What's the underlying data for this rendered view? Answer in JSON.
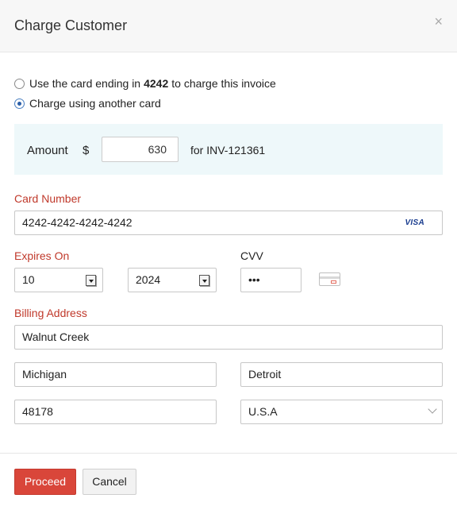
{
  "dialog": {
    "title": "Charge Customer",
    "close_glyph": "×"
  },
  "payment_options": [
    {
      "prefix": "Use the card ending in",
      "card_last4": "4242",
      "suffix": "to charge this invoice",
      "selected": false
    },
    {
      "label": "Charge using another card",
      "selected": true
    }
  ],
  "amount": {
    "label": "Amount",
    "currency": "$",
    "value": "630",
    "for_text": "for INV-121361"
  },
  "card": {
    "number_label": "Card Number",
    "number_value": "4242-4242-4242-4242",
    "brand": "VISA"
  },
  "expiry": {
    "label": "Expires On",
    "month": "10",
    "year": "2024"
  },
  "cvv": {
    "label": "CVV",
    "value": "•••",
    "icon": "card-cvv-icon"
  },
  "billing": {
    "label": "Billing Address",
    "street": "Walnut Creek",
    "state": "Michigan",
    "city": "Detroit",
    "zip": "48178",
    "country": "U.S.A"
  },
  "actions": {
    "proceed": "Proceed",
    "cancel": "Cancel"
  },
  "colors": {
    "accent_red": "#d9463a",
    "label_red": "#c0392b",
    "amount_bg": "#eef8fa"
  }
}
